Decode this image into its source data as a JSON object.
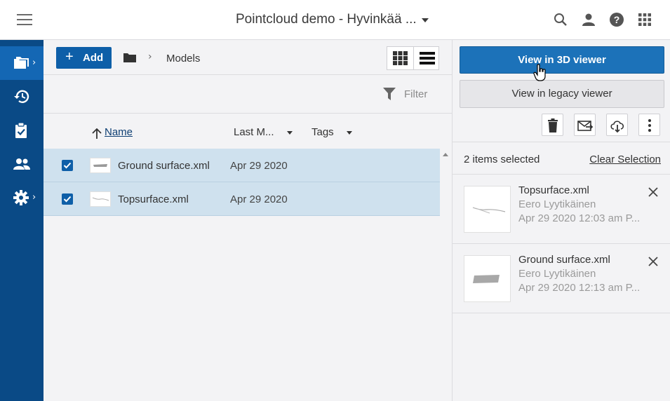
{
  "header": {
    "title": "Pointcloud demo - Hyvinkää ...",
    "icons": [
      "menu-icon",
      "search-icon",
      "user-icon",
      "help-icon",
      "apps-grid-icon"
    ]
  },
  "rail": {
    "items": [
      "folder-icon",
      "history-icon",
      "clipboard-check-icon",
      "people-icon",
      "settings-icon"
    ]
  },
  "toolbar": {
    "add_label": "Add",
    "breadcrumb_sep": "›",
    "breadcrumb_current": "Models"
  },
  "filter": {
    "label": "Filter"
  },
  "columns": {
    "name": "Name",
    "last_modified": "Last M...",
    "tags": "Tags"
  },
  "files": [
    {
      "name": "Ground surface.xml",
      "date": "Apr 29 2020",
      "checked": true
    },
    {
      "name": "Topsurface.xml",
      "date": "Apr 29 2020",
      "checked": true
    }
  ],
  "panel": {
    "view_3d_label": "View in 3D viewer",
    "view_legacy_label": "View in legacy viewer",
    "selected_count": "2 items selected",
    "clear_selection": "Clear Selection",
    "cards": [
      {
        "title": "Topsurface.xml",
        "author": "Eero Lyytikäinen",
        "date": "Apr 29 2020 12:03 am P..."
      },
      {
        "title": "Ground surface.xml",
        "author": "Eero Lyytikäinen",
        "date": "Apr 29 2020 12:13 am P..."
      }
    ]
  },
  "colors": {
    "rail_bg": "#0a4a86",
    "rail_active": "#1467b4",
    "primary": "#1c72b9",
    "selected_row": "#cfe1ee"
  }
}
